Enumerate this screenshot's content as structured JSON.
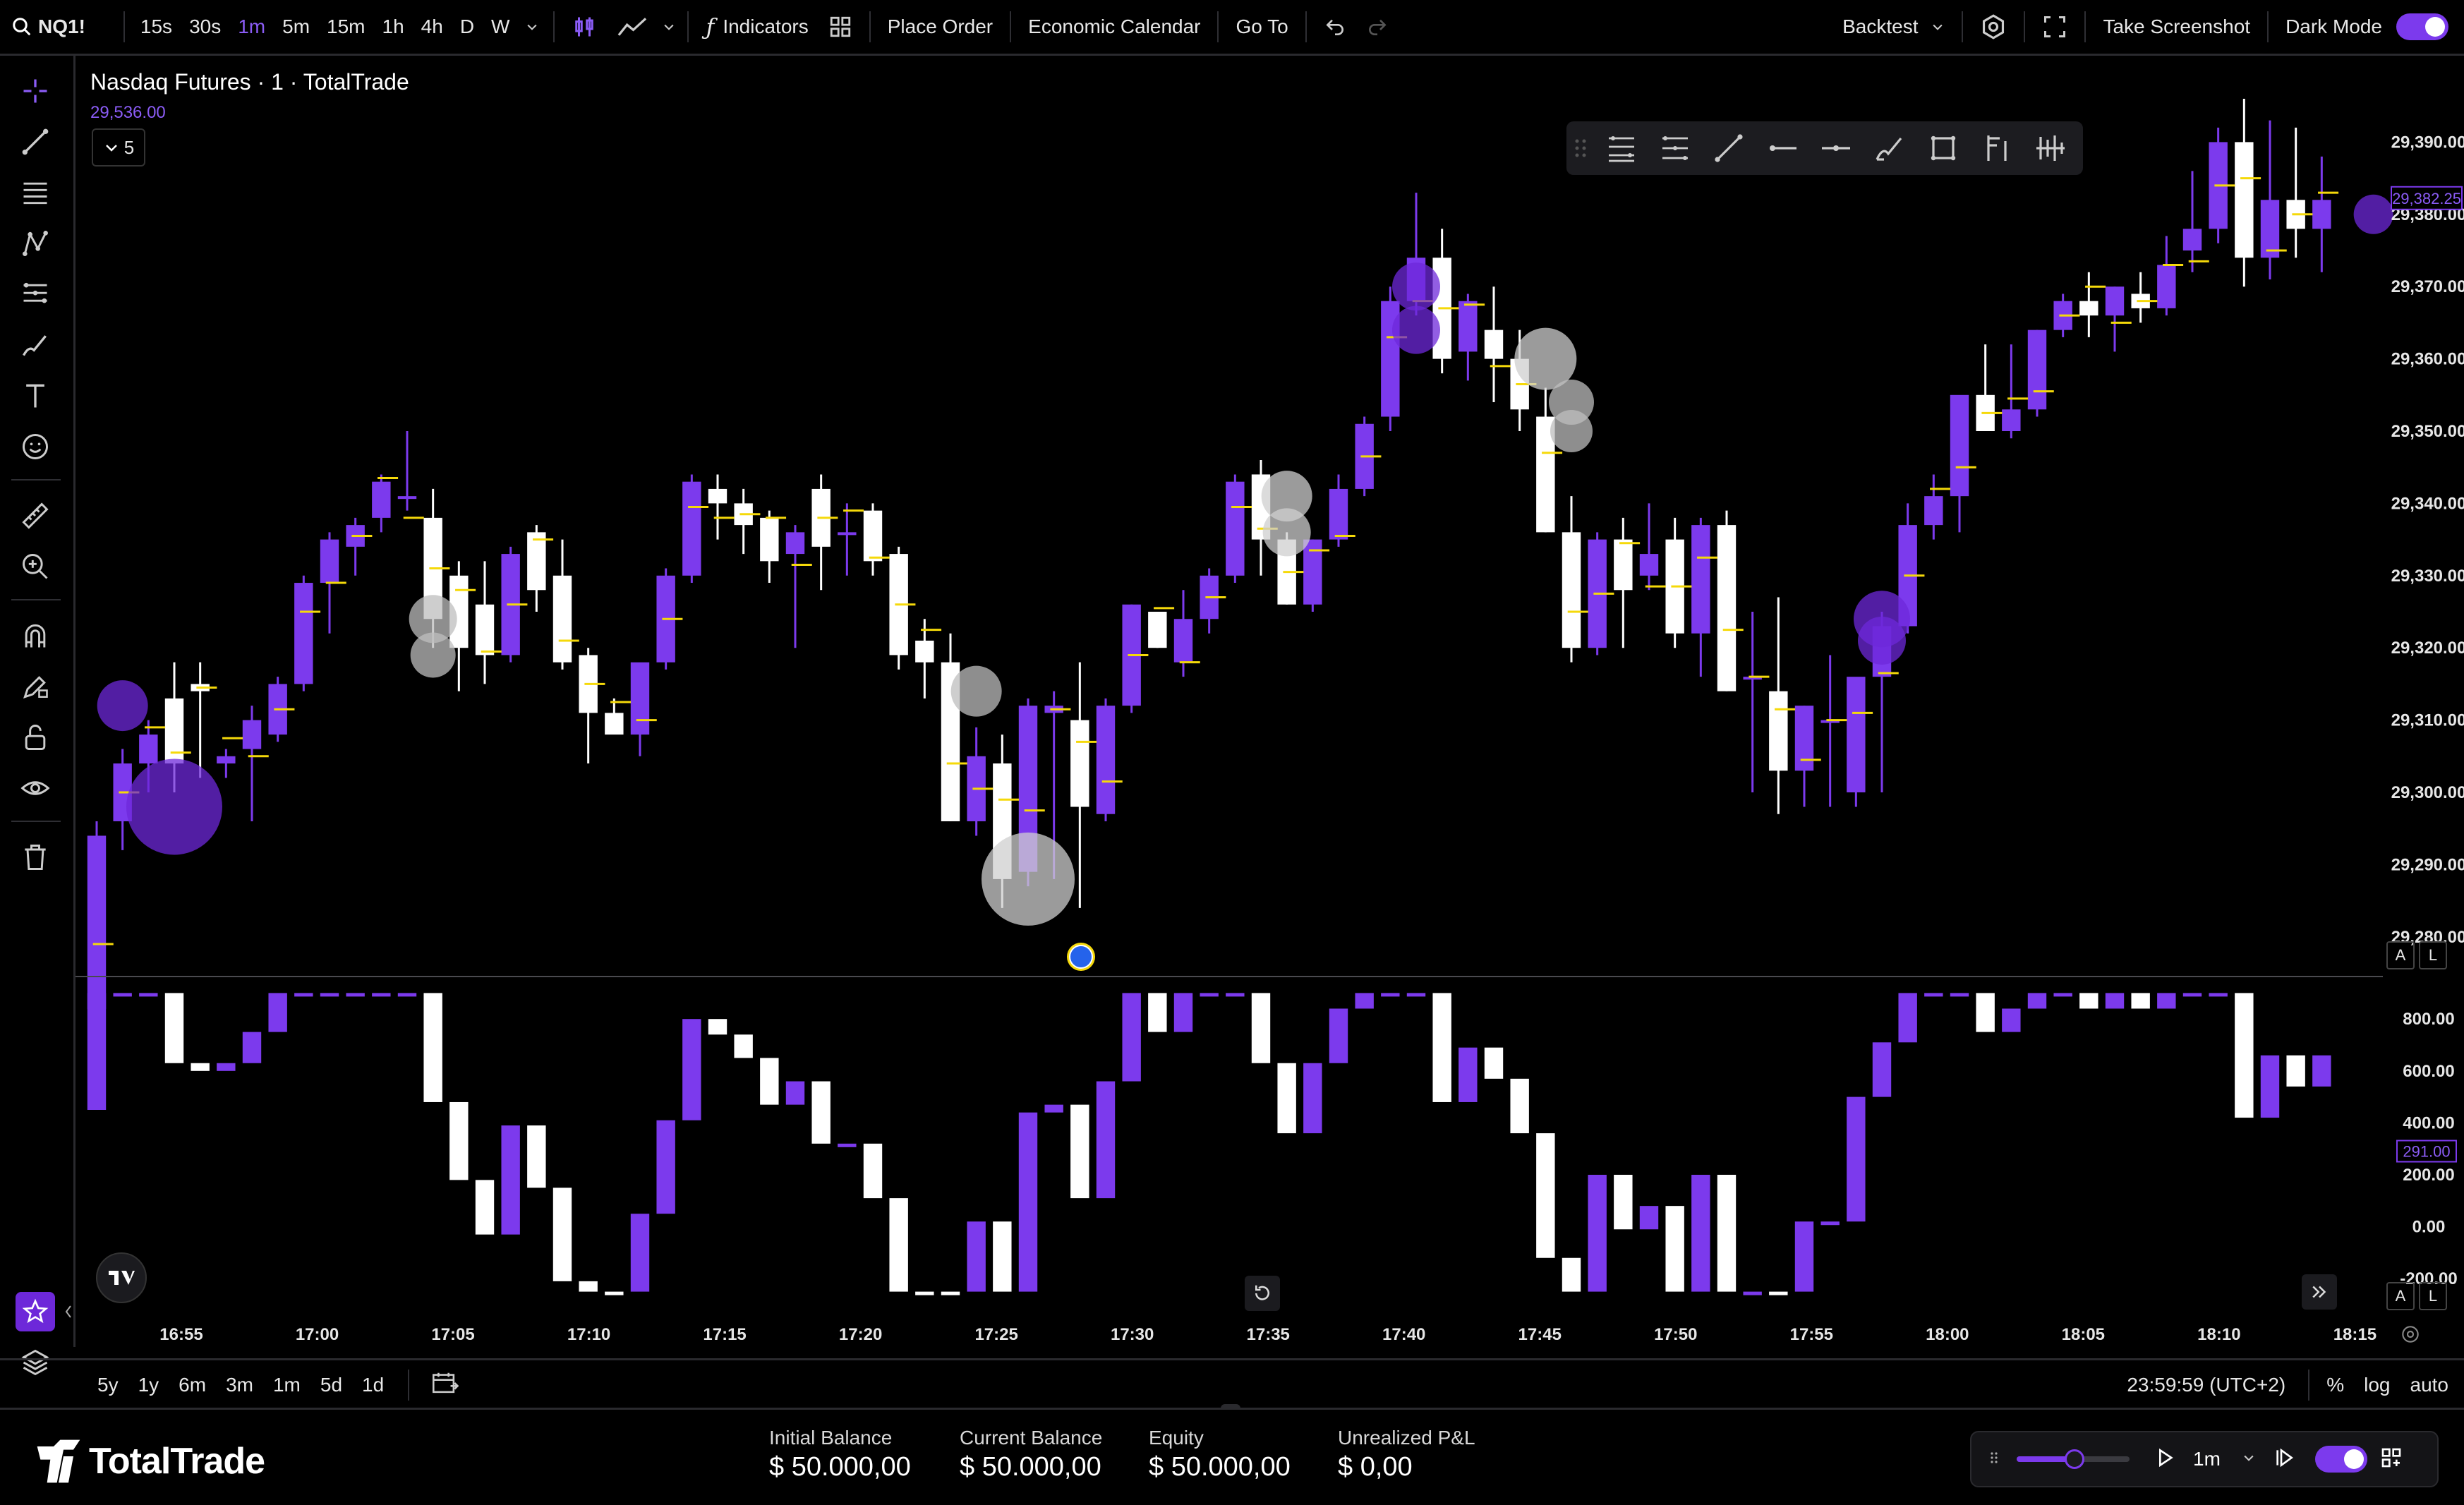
{
  "toolbar": {
    "symbol": "NQ1!",
    "intervals": [
      "15s",
      "30s",
      "1m",
      "5m",
      "15m",
      "1h",
      "4h",
      "D",
      "W"
    ],
    "active_interval": "1m",
    "indicators_label": "Indicators",
    "place_order_label": "Place Order",
    "economic_calendar_label": "Economic Calendar",
    "go_to_label": "Go To",
    "backtest_label": "Backtest",
    "take_screenshot_label": "Take Screenshot",
    "dark_mode_label": "Dark Mode"
  },
  "chart_header": {
    "title": "Nasdaq Futures · 1 · TotalTrade",
    "price": "29,536.00",
    "collapse_count": "5"
  },
  "chart_data": [
    {
      "type": "candlestick",
      "price_axis_ticks": [
        "29,390.00",
        "29,380.00",
        "29,370.00",
        "29,360.00",
        "29,350.00",
        "29,340.00",
        "29,330.00",
        "29,320.00",
        "29,310.00",
        "29,300.00",
        "29,290.00",
        "29,280.00"
      ],
      "ylim": [
        29275,
        29400
      ],
      "current_price_label": "29,382.25",
      "time_ticks": [
        "16:55",
        "17:00",
        "17:05",
        "17:10",
        "17:15",
        "17:20",
        "17:25",
        "17:30",
        "17:35",
        "17:40",
        "17:45",
        "17:50",
        "17:55",
        "18:00",
        "18:05",
        "18:10",
        "18:15"
      ],
      "bullish_color": "#7c3aed",
      "bearish_color": "#ffffff",
      "marker_color": "#f5d90a",
      "candles_ohlc": [
        [
          29270,
          29296,
          29268,
          29294
        ],
        [
          29296,
          29306,
          29292,
          29304
        ],
        [
          29304,
          29310,
          29300,
          29308
        ],
        [
          29313,
          29318,
          29300,
          29304
        ],
        [
          29315,
          29318,
          29302,
          29314
        ],
        [
          29304,
          29306,
          29302,
          29305
        ],
        [
          29306,
          29312,
          29296,
          29310
        ],
        [
          29308,
          29316,
          29307,
          29315
        ],
        [
          29315,
          29330,
          29314,
          29329
        ],
        [
          29329,
          29336,
          29322,
          29335
        ],
        [
          29334,
          29338,
          29330,
          29337
        ],
        [
          29338,
          29344,
          29336,
          29343
        ],
        [
          29341,
          29350,
          29339,
          29341
        ],
        [
          29338,
          29342,
          29320,
          29324
        ],
        [
          29330,
          29332,
          29314,
          29320
        ],
        [
          29326,
          29332,
          29315,
          29319
        ],
        [
          29319,
          29334,
          29318,
          29333
        ],
        [
          29336,
          29337,
          29325,
          29328
        ],
        [
          29330,
          29335,
          29317,
          29318
        ],
        [
          29319,
          29320,
          29304,
          29311
        ],
        [
          29311,
          29313,
          29309,
          29308
        ],
        [
          29308,
          29315,
          29305,
          29318
        ],
        [
          29318,
          29331,
          29317,
          29330
        ],
        [
          29330,
          29344,
          29329,
          29343
        ],
        [
          29342,
          29344,
          29335,
          29340
        ],
        [
          29340,
          29342,
          29333,
          29337
        ],
        [
          29338,
          29339,
          29329,
          29332
        ],
        [
          29333,
          29337,
          29320,
          29336
        ],
        [
          29342,
          29344,
          29328,
          29334
        ],
        [
          29336,
          29340,
          29330,
          29336
        ],
        [
          29339,
          29340,
          29330,
          29332
        ],
        [
          29333,
          29334,
          29317,
          29319
        ],
        [
          29321,
          29324,
          29313,
          29318
        ],
        [
          29318,
          29322,
          29296,
          29296
        ],
        [
          29296,
          29309,
          29294,
          29305
        ],
        [
          29304,
          29308,
          29284,
          29288
        ],
        [
          29289,
          29313,
          29287,
          29312
        ],
        [
          29311,
          29314,
          29288,
          29312
        ],
        [
          29310,
          29318,
          29284,
          29298
        ],
        [
          29297,
          29313,
          29296,
          29312
        ],
        [
          29312,
          29326,
          29311,
          29326
        ],
        [
          29325,
          29325,
          29320,
          29320
        ],
        [
          29318,
          29328,
          29316,
          29324
        ],
        [
          29324,
          29331,
          29322,
          29330
        ],
        [
          29330,
          29344,
          29329,
          29343
        ],
        [
          29344,
          29346,
          29330,
          29335
        ],
        [
          29335,
          29336,
          29326,
          29326
        ],
        [
          29326,
          29335,
          29325,
          29335
        ],
        [
          29335,
          29344,
          29334,
          29342
        ],
        [
          29342,
          29352,
          29341,
          29351
        ],
        [
          29352,
          29370,
          29350,
          29368
        ],
        [
          29368,
          29383,
          29366,
          29374
        ],
        [
          29374,
          29378,
          29358,
          29360
        ],
        [
          29361,
          29369,
          29357,
          29368
        ],
        [
          29364,
          29370,
          29354,
          29360
        ],
        [
          29360,
          29364,
          29350,
          29353
        ],
        [
          29352,
          29356,
          29336,
          29336
        ],
        [
          29336,
          29341,
          29318,
          29320
        ],
        [
          29320,
          29336,
          29319,
          29335
        ],
        [
          29335,
          29338,
          29320,
          29328
        ],
        [
          29330,
          29340,
          29328,
          29333
        ],
        [
          29335,
          29338,
          29320,
          29322
        ],
        [
          29322,
          29338,
          29316,
          29337
        ],
        [
          29337,
          29339,
          29314,
          29314
        ],
        [
          29316,
          29325,
          29300,
          29316
        ],
        [
          29314,
          29327,
          29297,
          29303
        ],
        [
          29303,
          29312,
          29298,
          29312
        ],
        [
          29310,
          29319,
          29298,
          29310
        ],
        [
          29300,
          29311,
          29298,
          29316
        ],
        [
          29316,
          29325,
          29300,
          29323
        ],
        [
          29323,
          29340,
          29322,
          29337
        ],
        [
          29337,
          29344,
          29335,
          29341
        ],
        [
          29341,
          29350,
          29336,
          29355
        ],
        [
          29355,
          29362,
          29353,
          29350
        ],
        [
          29350,
          29362,
          29349,
          29353
        ],
        [
          29353,
          29364,
          29352,
          29364
        ],
        [
          29364,
          29369,
          29363,
          29368
        ],
        [
          29368,
          29372,
          29363,
          29366
        ],
        [
          29366,
          29370,
          29361,
          29370
        ],
        [
          29369,
          29372,
          29365,
          29367
        ],
        [
          29367,
          29377,
          29366,
          29373
        ],
        [
          29375,
          29386,
          29372,
          29378
        ],
        [
          29378,
          29392,
          29376,
          29390
        ],
        [
          29390,
          29396,
          29370,
          29374
        ],
        [
          29374,
          29393,
          29371,
          29382
        ],
        [
          29382,
          29392,
          29374,
          29378
        ],
        [
          29378,
          29388,
          29372,
          29382
        ]
      ]
    },
    {
      "type": "bar",
      "name": "delta",
      "value_axis_ticks": [
        "800.00",
        "600.00",
        "400.00",
        "200.00",
        "0.00",
        "-200.00"
      ],
      "ylim": [
        -300,
        950
      ],
      "current_value_label": "291.00"
    }
  ],
  "footer": {
    "brand": "TotalTrade",
    "initial_balance_label": "Initial Balance",
    "initial_balance_value": "$ 50.000,00",
    "current_balance_label": "Current Balance",
    "current_balance_value": "$ 50.000,00",
    "equity_label": "Equity",
    "equity_value": "$ 50.000,00",
    "unrealized_label": "Unrealized P&L",
    "unrealized_value": "$ 0,00",
    "replay_interval": "1m"
  },
  "bottombar": {
    "ranges": [
      "5y",
      "1y",
      "6m",
      "3m",
      "1m",
      "5d",
      "1d"
    ],
    "clock": "23:59:59 (UTC+2)",
    "percent_label": "%",
    "log_label": "log",
    "auto_label": "auto"
  },
  "axis_buttons": {
    "a": "A",
    "l": "L"
  }
}
